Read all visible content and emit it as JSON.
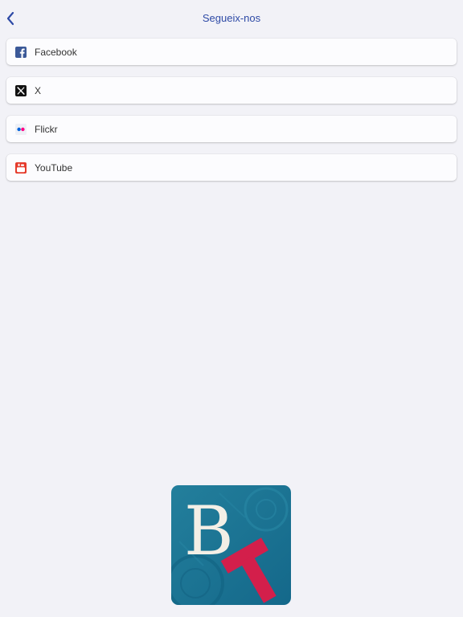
{
  "header": {
    "title": "Segueix-nos",
    "back_icon": "chevron-left-icon"
  },
  "colors": {
    "background": "#f2f2f7",
    "accent": "#2e4aa6",
    "facebook": "#3b5998",
    "x": "#111111",
    "flickr_blue": "#0063dc",
    "flickr_pink": "#ff0084",
    "youtube": "#e53b2c",
    "logo_teal": "#1b7896",
    "logo_red": "#d31f4b",
    "logo_cream": "#f3efe6"
  },
  "social_links": [
    {
      "label": "Facebook",
      "icon": "facebook-icon"
    },
    {
      "label": "X",
      "icon": "x-icon"
    },
    {
      "label": "Flickr",
      "icon": "flickr-icon"
    },
    {
      "label": "YouTube",
      "icon": "youtube-icon"
    }
  ],
  "logo": {
    "letters": "BT"
  }
}
